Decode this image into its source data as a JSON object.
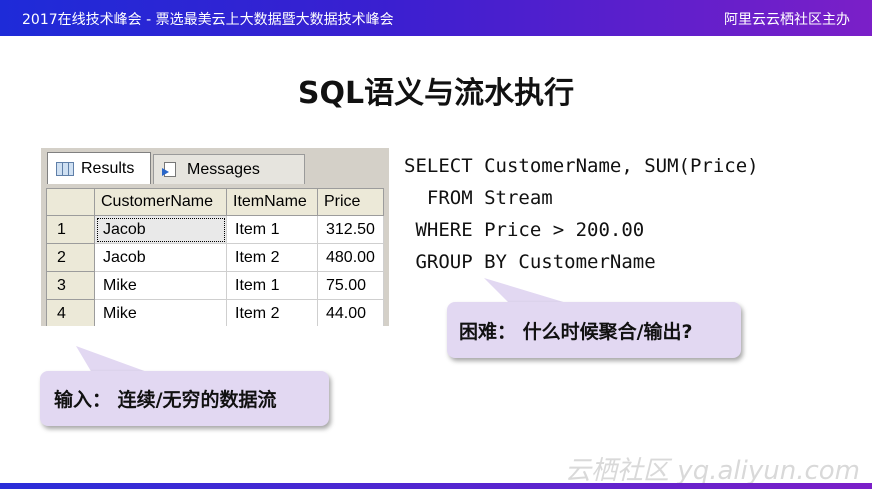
{
  "banner": {
    "left_text": "2017在线技术峰会 - 票选最美云上大数据暨大数据技术峰会",
    "right_text": "阿里云云栖社区主办"
  },
  "slide": {
    "title": "SQL语义与流水执行"
  },
  "results_panel": {
    "tabs": [
      {
        "label": "Results",
        "icon": "grid-icon",
        "active": true
      },
      {
        "label": "Messages",
        "icon": "messages-icon",
        "active": false
      }
    ],
    "columns": [
      "CustomerName",
      "ItemName",
      "Price"
    ],
    "rows": [
      {
        "num": "1",
        "customer": "Jacob",
        "item": "Item 1",
        "price": "312.50"
      },
      {
        "num": "2",
        "customer": "Jacob",
        "item": "Item 2",
        "price": "480.00"
      },
      {
        "num": "3",
        "customer": "Mike",
        "item": "Item 1",
        "price": "75.00"
      },
      {
        "num": "4",
        "customer": "Mike",
        "item": "Item 2",
        "price": "44.00"
      }
    ]
  },
  "sql": {
    "lines": [
      "SELECT CustomerName, SUM(Price)",
      "  FROM Stream",
      " WHERE Price > 200.00",
      " GROUP BY CustomerName"
    ]
  },
  "callouts": {
    "difficulty": "困难： 什么时候聚合/输出?",
    "input": "输入： 连续/无穷的数据流"
  },
  "watermark": "云栖社区 yq.aliyun.com",
  "colors": {
    "banner_start": "#1e2bd8",
    "banner_end": "#7b1fc8",
    "callout_bg": "#e2d8f2"
  }
}
